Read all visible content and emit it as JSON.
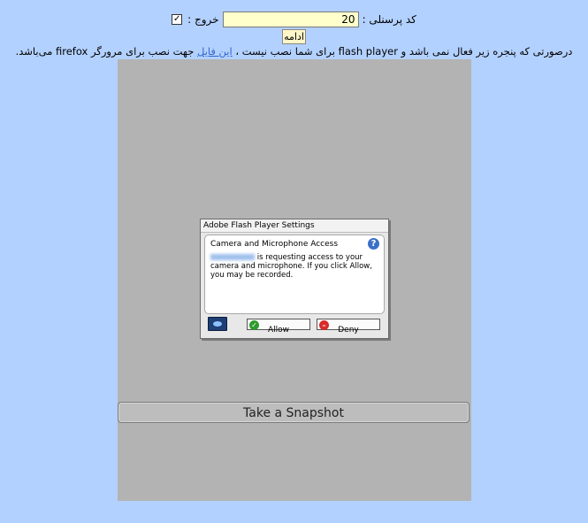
{
  "form": {
    "code_label": "کد پرسنلی :",
    "code_value": "20",
    "exit_label": "خروج :",
    "exit_checked": true,
    "submit_label": "ادامه"
  },
  "notice": {
    "text_before": "درصورتی که پنجره زیر فعال نمی باشد و",
    "flash_word": "flash player",
    "text_middle": " برای شما نصب نیست ، ",
    "link_text": "این فایل",
    "text_after": " جهت نصب برای مرورگر",
    "browser_word": "firefox",
    "text_end": " می‌باشد."
  },
  "flash_dialog": {
    "title": "Adobe Flash Player Settings",
    "heading": "Camera and Microphone Access",
    "message": "is requesting access to your camera and microphone. If you click Allow, you may be recorded.",
    "allow_label": "Allow",
    "deny_label": "Deny"
  },
  "snapshot_button": "Take a Snapshot",
  "colors": {
    "page_bg": "#b3d1ff",
    "stage_bg": "#b3b3b3",
    "input_bg": "#ffffcc",
    "link": "#3366cc"
  }
}
